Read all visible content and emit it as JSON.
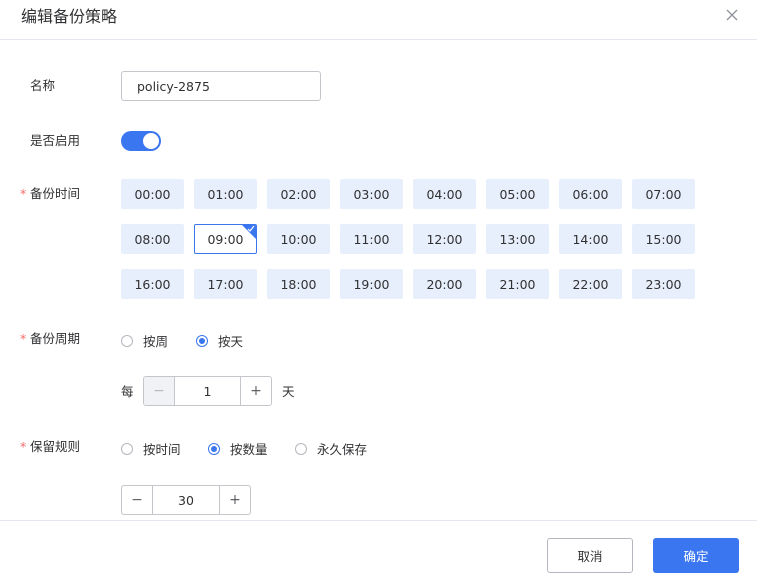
{
  "dialog": {
    "title": "编辑备份策略",
    "close_icon": "close-icon"
  },
  "form": {
    "name_label": "名称",
    "name_value": "policy-2875",
    "enable_label": "是否启用",
    "enabled": true,
    "time_label": "备份时间",
    "times": [
      "00:00",
      "01:00",
      "02:00",
      "03:00",
      "04:00",
      "05:00",
      "06:00",
      "07:00",
      "08:00",
      "09:00",
      "10:00",
      "11:00",
      "12:00",
      "13:00",
      "14:00",
      "15:00",
      "16:00",
      "17:00",
      "18:00",
      "19:00",
      "20:00",
      "21:00",
      "22:00",
      "23:00"
    ],
    "selected_time": "09:00",
    "cycle_label": "备份周期",
    "cycle_options": [
      "按周",
      "按天"
    ],
    "cycle_selected": "按天",
    "every_prefix": "每",
    "every_value": "1",
    "every_unit": "天",
    "retention_label": "保留规则",
    "retention_options": [
      "按时间",
      "按数量",
      "永久保存"
    ],
    "retention_selected": "按数量",
    "retention_value": "30",
    "required_mark": "*"
  },
  "footer": {
    "cancel_label": "取消",
    "ok_label": "确定"
  },
  "colors": {
    "accent": "#3a76ef",
    "cell_bg": "#e8effc",
    "required": "#f56c6c"
  }
}
